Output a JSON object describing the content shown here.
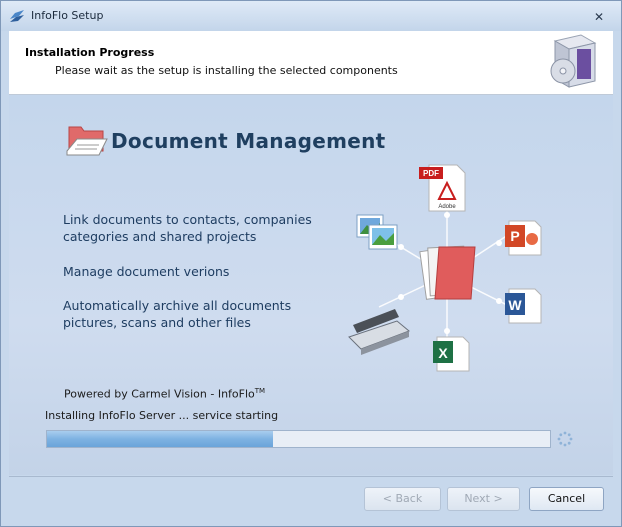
{
  "window": {
    "title": "InfoFlo Setup",
    "close_glyph": "✕"
  },
  "header": {
    "title": "Installation Progress",
    "subtitle": "Please wait as the setup is installing the selected components",
    "icon": "software-box-icon"
  },
  "slide": {
    "title": "Document Management",
    "features": [
      [
        "Link documents to contacts, companies",
        "categories and shared projects"
      ],
      [
        "Manage document verions"
      ],
      [
        "Automatically archive all documents",
        "pictures, scans and other files"
      ]
    ],
    "diagram_labels": {
      "pdf": "PDF",
      "adobe": "Adobe"
    }
  },
  "powered_by": {
    "text": "Powered by Carmel Vision - InfoFlo",
    "tm": "TM"
  },
  "status_text": "Installing InfoFlo Server ... service starting",
  "progress": {
    "fraction": 0.45
  },
  "buttons": {
    "back": "< Back",
    "next": "Next >",
    "cancel": "Cancel"
  },
  "colors": {
    "accent": "#7eb2e2",
    "title_blue": "#1f3f60"
  }
}
